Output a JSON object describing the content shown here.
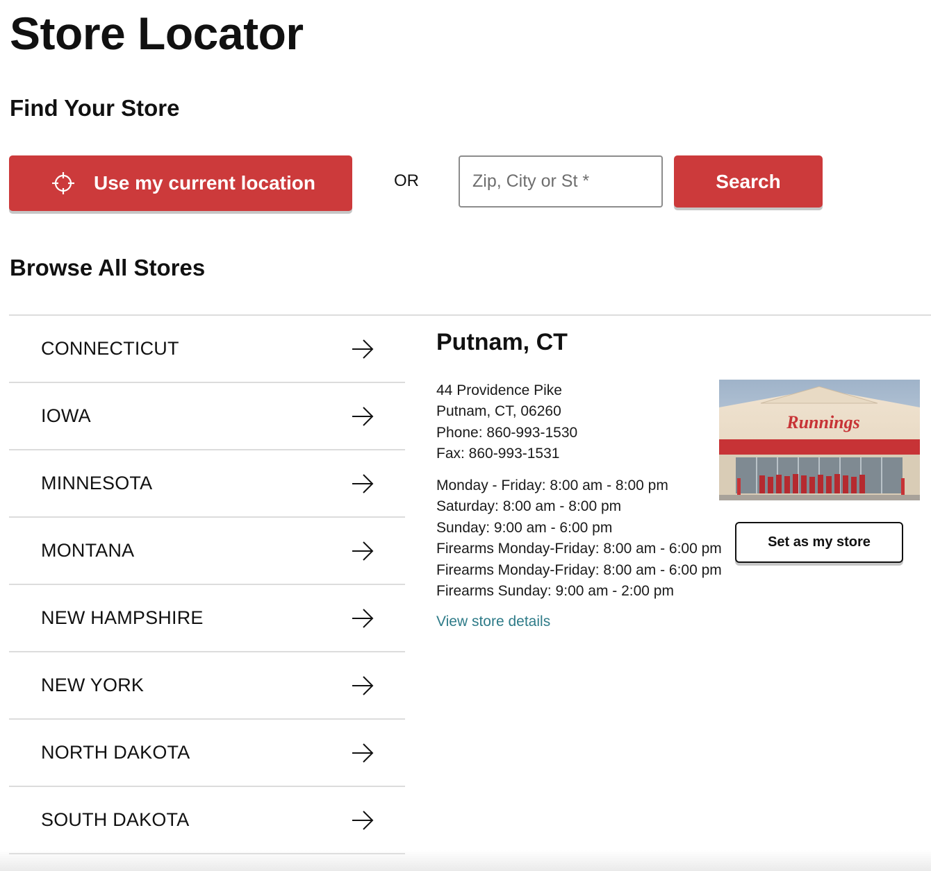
{
  "page": {
    "title": "Store Locator",
    "find_heading": "Find Your Store",
    "browse_heading": "Browse All Stores"
  },
  "search": {
    "location_button_label": "Use my current location",
    "or_label": "OR",
    "zip_placeholder": "Zip, City or St *",
    "zip_value": "",
    "search_button_label": "Search"
  },
  "states": [
    {
      "label": "CONNECTICUT"
    },
    {
      "label": "IOWA"
    },
    {
      "label": "MINNESOTA"
    },
    {
      "label": "MONTANA"
    },
    {
      "label": "NEW HAMPSHIRE"
    },
    {
      "label": "NEW YORK"
    },
    {
      "label": "NORTH DAKOTA"
    },
    {
      "label": "SOUTH DAKOTA"
    }
  ],
  "store": {
    "name": "Putnam, CT",
    "address_line1": "44 Providence Pike",
    "address_line2": "Putnam, CT, 06260",
    "phone": "Phone: 860-993-1530",
    "fax": "Fax: 860-993-1531",
    "hours": [
      "Monday - Friday: 8:00 am - 8:00 pm",
      "Saturday: 8:00 am - 8:00 pm",
      "Sunday: 9:00 am - 6:00 pm",
      "Firearms Monday-Friday: 8:00 am - 6:00 pm",
      "Firearms Monday-Friday: 8:00 am - 6:00 pm",
      "Firearms Sunday: 9:00 am - 2:00 pm"
    ],
    "details_link_label": "View store details",
    "set_store_label": "Set as my store",
    "photo_sign_text": "Runnings"
  },
  "icons": {
    "location": "crosshair-icon",
    "arrow": "arrow-right-icon"
  },
  "colors": {
    "brand_red": "#cc3a3b",
    "link_teal": "#2e7b88",
    "divider": "#dcdcdc"
  }
}
